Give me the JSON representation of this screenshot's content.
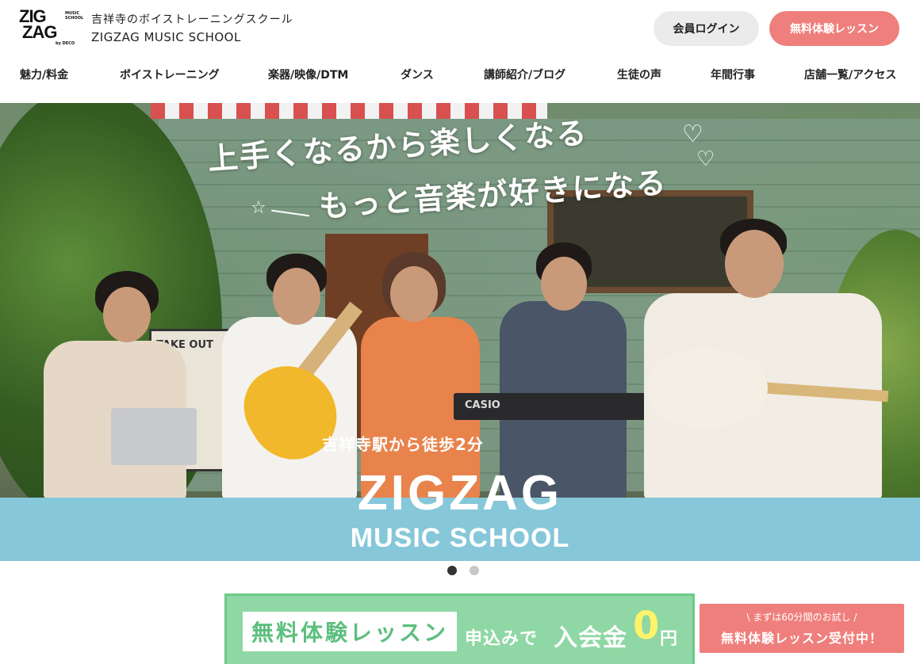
{
  "header": {
    "logo_line1": "ZIG",
    "logo_line2": "ZAG",
    "logo_small": "MUSIC SCHOOL",
    "logo_by": "by DECO",
    "tagline": "吉祥寺のボイストレーニングスクール",
    "school_name": "ZIGZAG MUSIC SCHOOL",
    "login_label": "会員ログイン",
    "trial_label": "無料体験レッスン"
  },
  "nav": {
    "items": [
      {
        "label": "魅力/料金"
      },
      {
        "label": "ボイストレーニング"
      },
      {
        "label": "楽器/映像/DTM"
      },
      {
        "label": "ダンス"
      },
      {
        "label": "講師紹介/ブログ"
      },
      {
        "label": "生徒の声"
      },
      {
        "label": "年間行事"
      },
      {
        "label": "店舗一覧/アクセス"
      }
    ]
  },
  "hero": {
    "copy_line1": "上手くなるから楽しくなる",
    "copy_line2": "もっと音楽が好きになる",
    "sign_text": "TAKE OUT CAK",
    "keyboard_brand": "CASIO",
    "station": "吉祥寺駅から徒歩2分",
    "brand_big": "ZIGZAG",
    "brand_sub": "MUSIC SCHOOL",
    "band_color": "#86c7d9"
  },
  "carousel": {
    "active_index": 0,
    "count": 2
  },
  "banner": {
    "label": "無料体験レッスン",
    "text_apply": "申込みで",
    "text_fee": "入会金",
    "text_zero": "0",
    "text_yen": "円"
  },
  "side_cta": {
    "line1": "\\ まずは60分間のお試し /",
    "line2": "無料体験レッスン受付中！"
  },
  "colors": {
    "accent_pink": "#ef7f7c",
    "accent_green": "#8fd7a4",
    "accent_blue": "#86c7d9"
  }
}
